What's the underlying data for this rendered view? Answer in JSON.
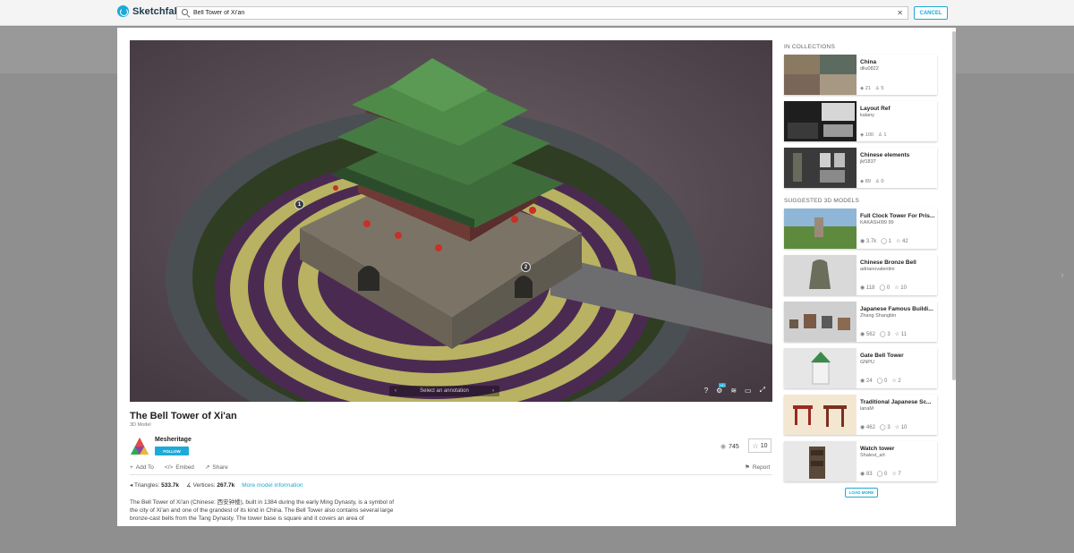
{
  "header": {
    "brand": "Sketchfab",
    "search_value": "Bell Tower of Xi'an",
    "cancel_label": "CANCEL"
  },
  "viewer": {
    "annotation_label": "Select an annotation",
    "annotation_1": "1",
    "annotation_2": "2",
    "hd_badge": "HD"
  },
  "model": {
    "title": "The Bell Tower of Xi'an",
    "subtitle": "3D Model",
    "author": "Mesheritage",
    "follow_label": "FOLLOW",
    "views": "745",
    "likes": "10",
    "add_to": "Add To",
    "embed": "Embed",
    "share": "Share",
    "report": "Report",
    "triangles_label": "Triangles:",
    "triangles": "533.7k",
    "vertices_label": "Vertices:",
    "vertices": "267.7k",
    "more_info": "More model information",
    "description": "The Bell Tower of Xi'an (Chinese: 西安钟楼), built in 1384 during the early Ming Dynasty, is a symbol of the city of Xi'an and one of the grandest of its kind in China. The Bell Tower also contains several large bronze-cast bells from the Tang Dynasty. The tower base is square and it covers an area of"
  },
  "sidebar": {
    "collections_heading": "IN COLLECTIONS",
    "suggested_heading": "SUGGESTED 3D MODELS",
    "collections": [
      {
        "title": "China",
        "author": "dliu0822",
        "models": "21",
        "members": "5"
      },
      {
        "title": "Layout Ref",
        "author": "kalany",
        "models": "100",
        "members": "1"
      },
      {
        "title": "Chinese elements",
        "author": "jkf1837",
        "models": "89",
        "members": "0"
      }
    ],
    "suggested": [
      {
        "title": "Full Clock Tower For Pris...",
        "author": "KAKASHI99 99",
        "views": "3.7k",
        "comments": "1",
        "likes": "42"
      },
      {
        "title": "Chinese Bronze Bell",
        "author": "adrianovalentini",
        "views": "118",
        "comments": "0",
        "likes": "10"
      },
      {
        "title": "Japanese Famous Buildi...",
        "author": "Zhang Shangbin",
        "views": "562",
        "comments": "3",
        "likes": "11"
      },
      {
        "title": "Gate Bell Tower",
        "author": "GNPU",
        "views": "24",
        "comments": "0",
        "likes": "2"
      },
      {
        "title": "Traditional Japanese Sc...",
        "author": "lanaM",
        "views": "462",
        "comments": "3",
        "likes": "10"
      },
      {
        "title": "Watch tower",
        "author": "Shalest_art",
        "views": "83",
        "comments": "0",
        "likes": "7"
      }
    ],
    "load_more": "LOAD MORE"
  }
}
